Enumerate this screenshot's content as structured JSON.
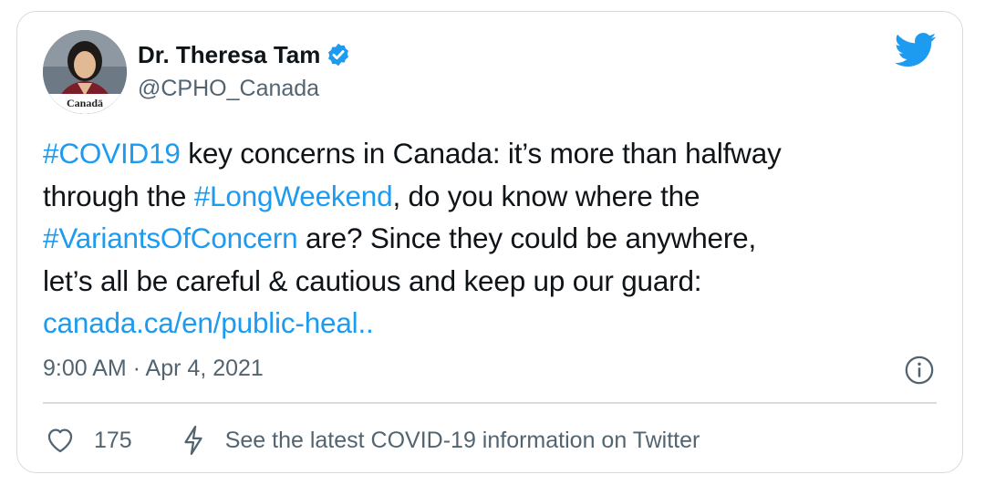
{
  "author": {
    "display_name": "Dr. Theresa Tam",
    "handle": "@CPHO_Canada",
    "avatar_brand": "Canadä"
  },
  "tweet": {
    "lines": [
      [
        {
          "text": "#COVID19",
          "link": true
        },
        {
          "text": " key concerns in Canada: it’s more than halfway",
          "link": false
        }
      ],
      [
        {
          "text": "through the ",
          "link": false
        },
        {
          "text": "#LongWeekend",
          "link": true
        },
        {
          "text": ", do you know where the",
          "link": false
        }
      ],
      [
        {
          "text": "#VariantsOfConcern",
          "link": true
        },
        {
          "text": " are? Since they could be anywhere,",
          "link": false
        }
      ],
      [
        {
          "text": "let’s all be careful & cautious and keep up our guard:",
          "link": false
        }
      ],
      [
        {
          "text": "canada.ca/en/public-heal..",
          "link": true
        }
      ]
    ],
    "timestamp": "9:00 AM · Apr 4, 2021"
  },
  "footer": {
    "like_count": "175",
    "covid_info_text": "See the latest COVID-19 information on Twitter"
  },
  "colors": {
    "link": "#1d9bf0",
    "text": "#0f1419",
    "secondary": "#536471",
    "border": "#d6dbe0"
  },
  "icons": [
    "verified-badge-icon",
    "twitter-bird-icon",
    "info-icon",
    "heart-icon",
    "lightning-bolt-icon"
  ]
}
